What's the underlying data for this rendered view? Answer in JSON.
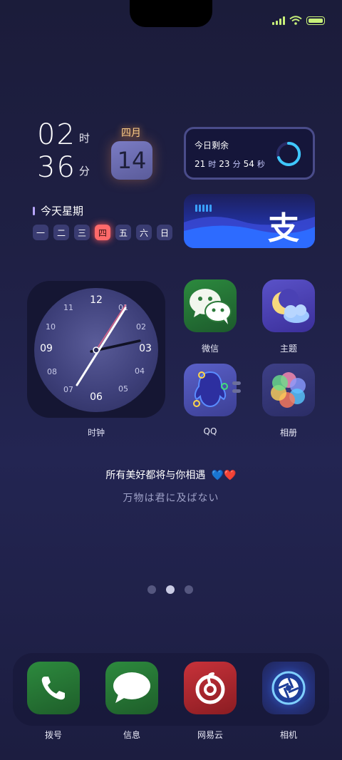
{
  "status": {
    "signal_icon": "signal-icon",
    "wifi_icon": "wifi-icon",
    "battery_icon": "battery-icon",
    "accent": "#c8f07a"
  },
  "time_widget": {
    "hour": "02",
    "hour_unit": "时",
    "minute": "36",
    "minute_unit": "分",
    "month": "四月",
    "day": "14"
  },
  "week_widget": {
    "title": "今天星期",
    "days": [
      "一",
      "二",
      "三",
      "四",
      "五",
      "六",
      "日"
    ],
    "active_index": 3
  },
  "countdown_widget": {
    "title": "今日剩余",
    "hours": "21",
    "hours_unit": "时",
    "minutes": "23",
    "minutes_unit": "分",
    "seconds": "54",
    "seconds_unit": "秒"
  },
  "alipay_widget": {
    "glyph": "支"
  },
  "clock_widget": {
    "numbers": [
      "12",
      "01",
      "02",
      "03",
      "04",
      "05",
      "06",
      "07",
      "08",
      "09",
      "10",
      "11"
    ],
    "label": "时钟"
  },
  "apps": [
    {
      "label": "微信",
      "icon": "wechat-icon"
    },
    {
      "label": "主题",
      "icon": "theme-moon-icon"
    },
    {
      "label": "QQ",
      "icon": "qq-penguin-icon"
    },
    {
      "label": "相册",
      "icon": "gallery-flower-icon"
    }
  ],
  "quote": {
    "line1": "所有美好都将与你相遇",
    "line1_emoji": "💙❤️",
    "line2": "万物は君に及ばない"
  },
  "page_indicator": {
    "count": 3,
    "active": 1
  },
  "dock": [
    {
      "label": "拨号",
      "icon": "phone-icon"
    },
    {
      "label": "信息",
      "icon": "message-icon"
    },
    {
      "label": "网易云",
      "icon": "netease-music-icon"
    },
    {
      "label": "相机",
      "icon": "camera-icon"
    }
  ]
}
